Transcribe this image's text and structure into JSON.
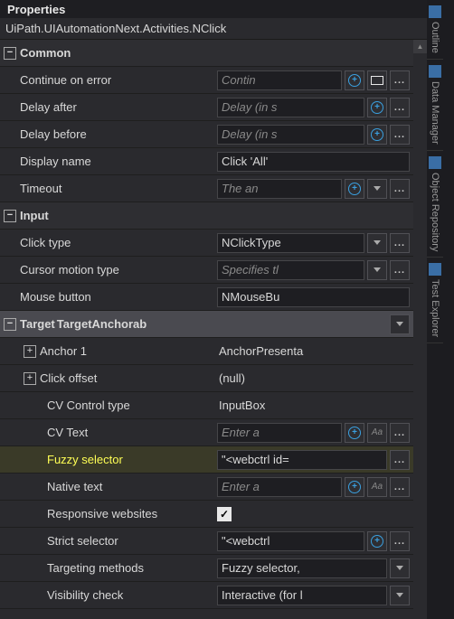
{
  "panel_title": "Properties",
  "class_path": "UiPath.UIAutomationNext.Activities.NClick",
  "categories": {
    "common": {
      "label": "Common",
      "props": {
        "continue_on_error": {
          "label": "Continue on error",
          "placeholder": "Contin"
        },
        "delay_after": {
          "label": "Delay after",
          "placeholder": "Delay (in s"
        },
        "delay_before": {
          "label": "Delay before",
          "placeholder": "Delay (in s"
        },
        "display_name": {
          "label": "Display name",
          "value": "Click 'All'"
        },
        "timeout": {
          "label": "Timeout",
          "placeholder": "The an"
        }
      }
    },
    "input": {
      "label": "Input",
      "props": {
        "click_type": {
          "label": "Click type",
          "value": "NClickType"
        },
        "cursor_motion": {
          "label": "Cursor motion type",
          "placeholder": "Specifies tl"
        },
        "mouse_button": {
          "label": "Mouse button",
          "value": "NMouseBu"
        }
      },
      "target": {
        "label": "Target",
        "value": "TargetAnchorab",
        "props": {
          "anchor1": {
            "label": "Anchor 1",
            "value": "AnchorPresenta"
          },
          "click_offset": {
            "label": "Click offset",
            "value": "(null)"
          },
          "cv_control_type": {
            "label": "CV Control type",
            "value": "InputBox"
          },
          "cv_text": {
            "label": "CV Text",
            "placeholder": "Enter a"
          },
          "fuzzy_selector": {
            "label": "Fuzzy selector",
            "value": "\"<webctrl id="
          },
          "native_text": {
            "label": "Native text",
            "placeholder": "Enter a"
          },
          "responsive_websites": {
            "label": "Responsive websites",
            "checked": true
          },
          "strict_selector": {
            "label": "Strict selector",
            "value": "\"<webctrl"
          },
          "targeting_methods": {
            "label": "Targeting methods",
            "value": "Fuzzy selector,"
          },
          "visibility_check": {
            "label": "Visibility check",
            "value": "Interactive (for l"
          }
        }
      }
    }
  },
  "side_tabs": [
    "Outline",
    "Data Manager",
    "Object Repository",
    "Test Explorer"
  ]
}
